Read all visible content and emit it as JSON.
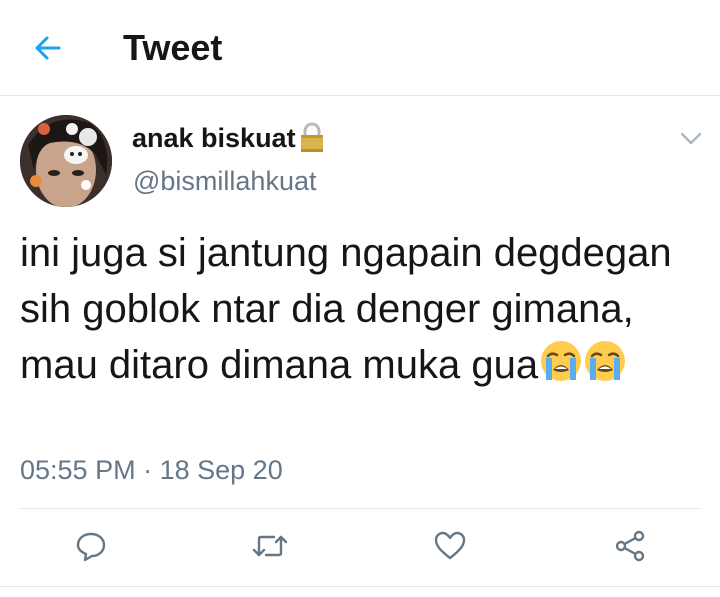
{
  "header": {
    "title": "Tweet",
    "back_icon": "back-arrow-icon",
    "accent_color": "#1da1f2"
  },
  "tweet": {
    "display_name": "anak biskuat",
    "handle": "@bismillahkuat",
    "protected_icon": "lock-icon",
    "text": "ini juga si jantung ngapain degdegan sih goblok ntar dia denger gimana, mau ditaro dimana muka gua",
    "emojis": [
      "loudly-crying-face-icon",
      "loudly-crying-face-icon"
    ],
    "time": "05:55 PM",
    "separator": "·",
    "date": "18 Sep 20"
  },
  "actions": [
    {
      "name": "reply",
      "icon": "reply-icon"
    },
    {
      "name": "retweet",
      "icon": "retweet-icon"
    },
    {
      "name": "like",
      "icon": "heart-icon"
    },
    {
      "name": "share",
      "icon": "share-icon"
    }
  ],
  "colors": {
    "text_primary": "#14171a",
    "text_secondary": "#657786",
    "divider": "#e1e8ed",
    "icon": "#657786"
  }
}
